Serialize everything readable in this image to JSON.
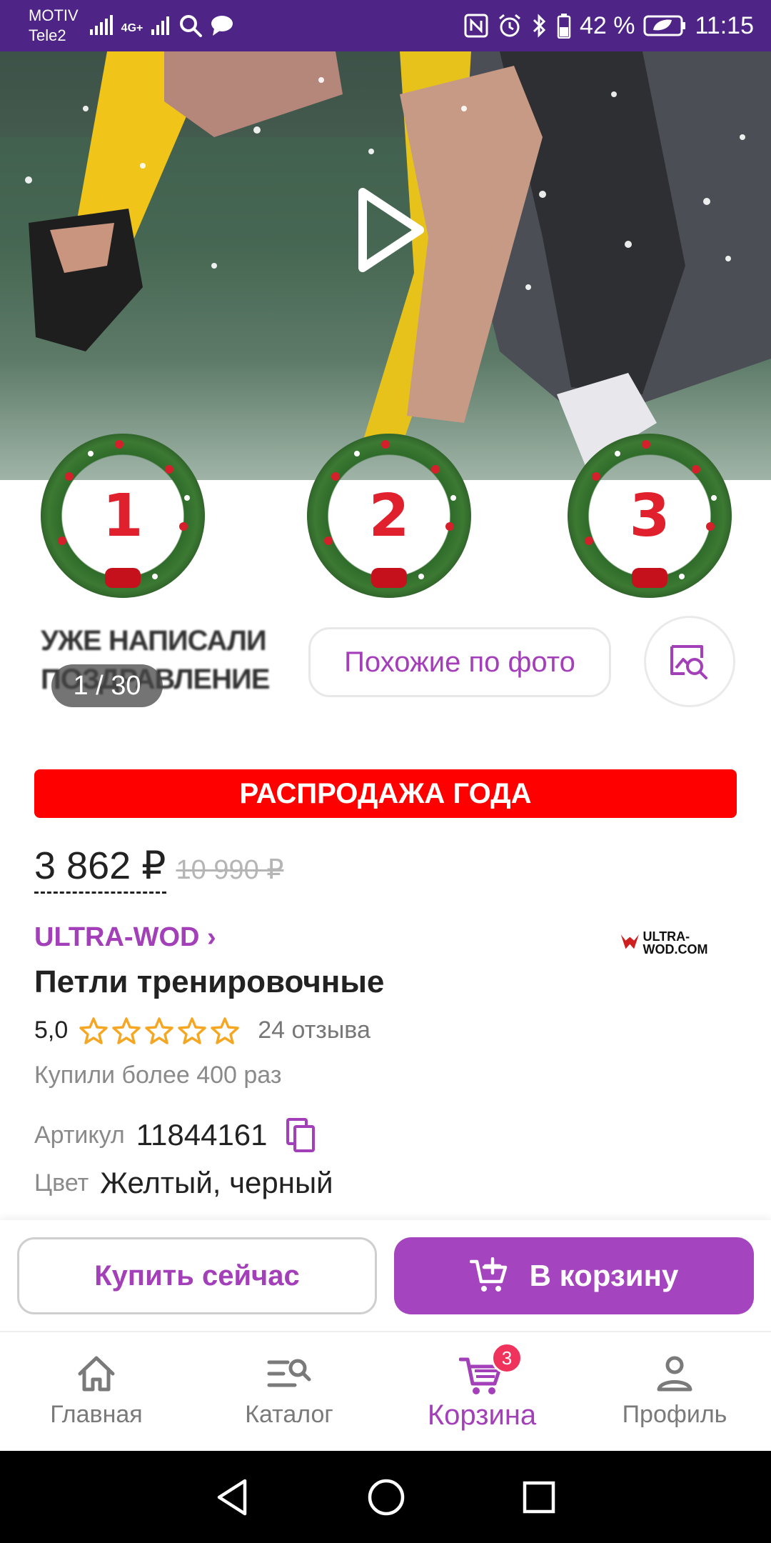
{
  "status_bar": {
    "carrier_1": "MOTIV",
    "carrier_2": "Tele2",
    "network": "4G+",
    "battery": "42 %",
    "time": "11:15"
  },
  "media": {
    "counter": "1 / 30",
    "similar_label": "Похожие по фото",
    "wreaths": [
      {
        "number": "1",
        "caption_line_1": "УЖЕ НАПИСАЛИ",
        "caption_line_2": "ПОЗДРАВЛЕНИЕ"
      },
      {
        "number": "2"
      },
      {
        "number": "3"
      }
    ]
  },
  "product": {
    "sale_banner": "РАСПРОДАЖА ГОДА",
    "price_current": "3 862 ₽",
    "price_old": "10 990 ₽",
    "brand": "ULTRA-WOD ›",
    "brand_logo_text": "ULTRA-WOD.COM",
    "title": "Петли тренировочные",
    "rating": "5,0",
    "stars": 5,
    "reviews": "24 отзыва",
    "bought": "Купили более 400 раз",
    "sku_label": "Артикул",
    "sku_value": "11844161",
    "color_label": "Цвет",
    "color_value": "Желтый, черный"
  },
  "actions": {
    "buy_now": "Купить сейчас",
    "add_to_cart": "В корзину"
  },
  "tabs": [
    {
      "label": "Главная",
      "icon": "home-icon"
    },
    {
      "label": "Каталог",
      "icon": "catalog-search-icon"
    },
    {
      "label": "Корзина",
      "icon": "cart-icon",
      "badge": "3",
      "active": true
    },
    {
      "label": "Профиль",
      "icon": "profile-icon"
    }
  ],
  "colors": {
    "accent": "#a33fb8",
    "status_bar": "#4e2486",
    "sale": "#ff0000",
    "star": "#f5a623",
    "badge": "#f0335d"
  }
}
